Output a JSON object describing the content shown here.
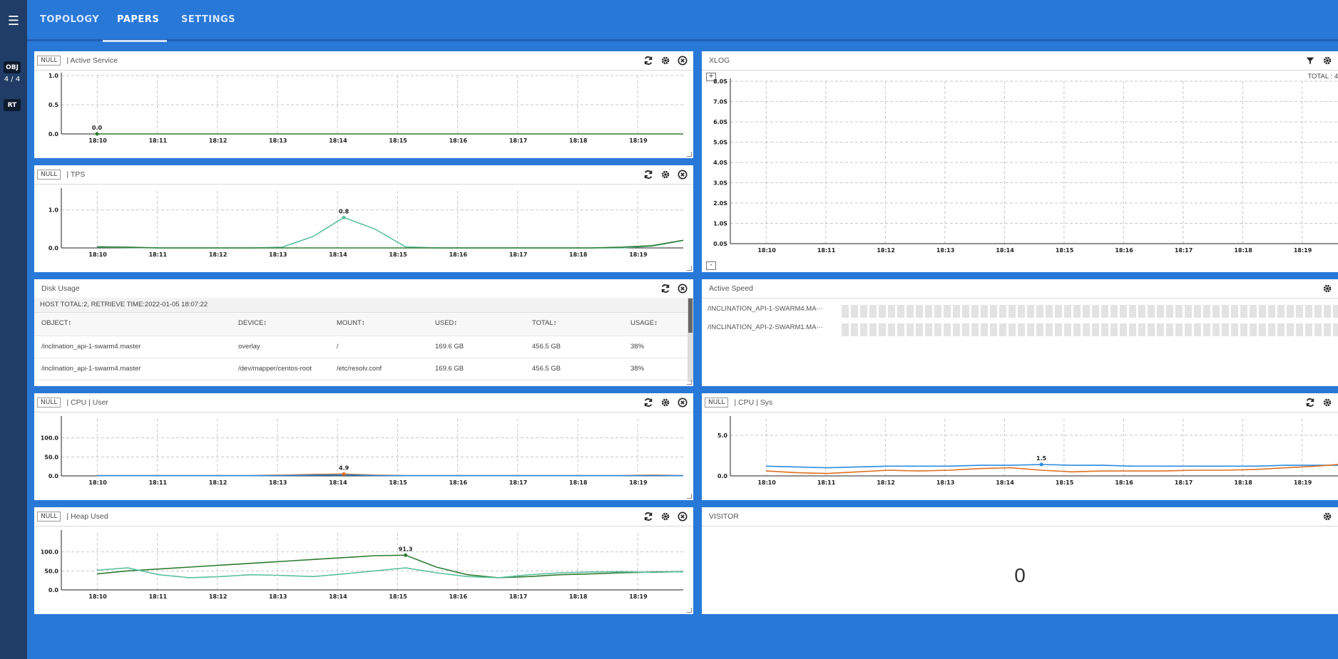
{
  "nav": {
    "menu_icon": "hamburger-icon",
    "tabs": [
      {
        "label": "TOPOLOGY"
      },
      {
        "label": "PAPERS"
      },
      {
        "label": "SETTINGS"
      }
    ],
    "rail": {
      "obj_label": "OBJ",
      "count": "4 / 4",
      "rt_label": "RT"
    }
  },
  "colors": {
    "accent": "#2878d8",
    "rail": "#1f3d67",
    "green": "#2e7d32",
    "mint": "#5cc0a0",
    "blue": "#2a8ce0",
    "orange": "#e07020"
  },
  "panels": {
    "active_service": {
      "null_label": "NULL",
      "title": "| Active Service",
      "peak_label": "0.0"
    },
    "tps": {
      "null_label": "NULL",
      "title": "| TPS",
      "peak_label": "0.8"
    },
    "disk": {
      "title": "Disk Usage",
      "info": "HOST TOTAL:2, RETRIEVE TIME:2022-01-05 18:07:22",
      "columns": [
        "OBJECT↕",
        "DEVICE↕",
        "MOUNT↕",
        "USED↕",
        "TOTAL↕",
        "USAGE↕"
      ],
      "rows": [
        [
          "/inclination_api-1-swarm4.master",
          "overlay",
          "/",
          "169.6 GB",
          "456.5 GB",
          "38%"
        ],
        [
          "/inclination_api-1-swarm4.master",
          "/dev/mapper/centos-root",
          "/etc/resolv.conf",
          "169.6 GB",
          "456.5 GB",
          "38%"
        ]
      ]
    },
    "cpu_user": {
      "null_label": "NULL",
      "title": "| CPU | User",
      "peak_label": "4.9"
    },
    "heap": {
      "null_label": "NULL",
      "title": "| Heap Used",
      "peak_label": "91.3"
    },
    "xlog": {
      "title": "XLOG",
      "total": "TOTAL : 4"
    },
    "speed": {
      "title": "Active Speed",
      "rows": [
        "/INCLINATION_API-1-SWARM4.MA···",
        "/INCLINATION_API-2-SWARM1.MA···"
      ]
    },
    "cpu_sys": {
      "null_label": "NULL",
      "title": "| CPU | Sys",
      "peak_label": "1.5"
    },
    "visitor": {
      "title": "VISITOR",
      "value": "0"
    }
  },
  "chart_data": [
    {
      "name": "active_service",
      "type": "line",
      "x": [
        "18:10",
        "18:11",
        "18:12",
        "18:13",
        "18:14",
        "18:15",
        "18:16",
        "18:17",
        "18:18",
        "18:19"
      ],
      "yticks": [
        "0.0",
        "0.5",
        "1.0"
      ],
      "ylim": [
        0,
        1
      ],
      "series": [
        {
          "values": [
            0,
            0,
            0,
            0,
            0,
            0,
            0,
            0,
            0,
            0,
            0,
            0,
            0,
            0,
            0,
            0,
            0,
            0,
            0,
            0
          ]
        }
      ]
    },
    {
      "name": "tps",
      "type": "line",
      "x": [
        "18:10",
        "18:11",
        "18:12",
        "18:13",
        "18:14",
        "18:15",
        "18:16",
        "18:17",
        "18:18",
        "18:19"
      ],
      "yticks": [
        "0.0",
        "1.0"
      ],
      "ylim": [
        0,
        1.5
      ],
      "series": [
        {
          "values": [
            0.02,
            0.01,
            0,
            0,
            0,
            0,
            0.02,
            0.3,
            0.8,
            0.5,
            0.03,
            0,
            0,
            0,
            0,
            0,
            0,
            0,
            0.05,
            0.2
          ]
        },
        {
          "values": [
            0.03,
            0.02,
            0,
            0,
            0,
            0,
            0,
            0,
            0,
            0,
            0,
            0,
            0,
            0,
            0,
            0,
            0,
            0.02,
            0.06,
            0.2
          ]
        }
      ]
    },
    {
      "name": "cpu_user",
      "type": "line",
      "x": [
        "18:10",
        "18:11",
        "18:12",
        "18:13",
        "18:14",
        "18:15",
        "18:16",
        "18:17",
        "18:18",
        "18:19"
      ],
      "yticks": [
        "0.0",
        "50.0",
        "100.0"
      ],
      "ylim": [
        0,
        150
      ],
      "series": [
        {
          "values": [
            1,
            1,
            1,
            1,
            1,
            1,
            2,
            4,
            4.9,
            2,
            1,
            1,
            1,
            1,
            1,
            1,
            1,
            1,
            2,
            1
          ]
        },
        {
          "values": [
            0.5,
            0.5,
            0.5,
            0.5,
            0.5,
            0.5,
            1,
            2,
            3,
            1,
            0.5,
            0.5,
            0.5,
            0.5,
            0.5,
            0.5,
            0.5,
            0.5,
            1,
            0.5
          ]
        }
      ]
    },
    {
      "name": "heap",
      "type": "line",
      "x": [
        "18:10",
        "18:11",
        "18:12",
        "18:13",
        "18:14",
        "18:15",
        "18:16",
        "18:17",
        "18:18",
        "18:19"
      ],
      "yticks": [
        "0.0",
        "50.0",
        "100.0"
      ],
      "ylim": [
        0,
        150
      ],
      "series": [
        {
          "values": [
            42,
            50,
            55,
            60,
            65,
            70,
            75,
            80,
            85,
            90,
            91.3,
            60,
            40,
            32,
            35,
            40,
            42,
            45,
            47,
            48
          ]
        },
        {
          "values": [
            52,
            58,
            40,
            32,
            35,
            40,
            38,
            35,
            42,
            50,
            58,
            45,
            35,
            32,
            40,
            45,
            47,
            48,
            46,
            48
          ]
        }
      ]
    },
    {
      "name": "xlog",
      "type": "scatter",
      "x": [
        "18:10",
        "18:11",
        "18:12",
        "18:13",
        "18:14",
        "18:15",
        "18:16",
        "18:17",
        "18:18",
        "18:19"
      ],
      "yticks": [
        "0.0S",
        "1.0S",
        "2.0S",
        "3.0S",
        "4.0S",
        "5.0S",
        "6.0S",
        "7.0S",
        "8.0S"
      ],
      "ylim": [
        0,
        8
      ]
    },
    {
      "name": "cpu_sys",
      "type": "line",
      "x": [
        "18:10",
        "18:11",
        "18:12",
        "18:13",
        "18:14",
        "18:15",
        "18:16",
        "18:17",
        "18:18",
        "18:19"
      ],
      "yticks": [
        "0.0",
        "5.0"
      ],
      "ylim": [
        0,
        7
      ],
      "series": [
        {
          "values": [
            1.2,
            1.1,
            1.0,
            1.1,
            1.2,
            1.2,
            1.2,
            1.3,
            1.3,
            1.4,
            1.3,
            1.3,
            1.2,
            1.2,
            1.2,
            1.2,
            1.2,
            1.3,
            1.3,
            1.3
          ]
        },
        {
          "values": [
            0.6,
            0.4,
            0.3,
            0.5,
            0.7,
            0.6,
            0.7,
            0.9,
            1.0,
            0.7,
            0.5,
            0.6,
            0.6,
            0.6,
            0.7,
            0.7,
            0.8,
            1.0,
            1.2,
            1.5
          ]
        }
      ]
    }
  ]
}
